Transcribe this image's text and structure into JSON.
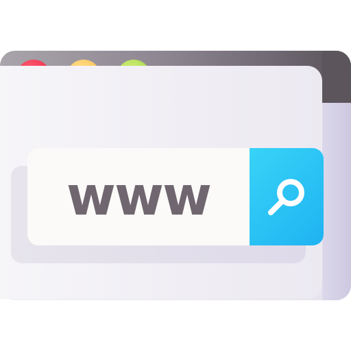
{
  "window": {
    "controls": [
      {
        "name": "close",
        "color": "#f02e4f"
      },
      {
        "name": "minimize",
        "color": "#fbc35a"
      },
      {
        "name": "maximize",
        "color": "#a9da4d"
      }
    ]
  },
  "address_bar": {
    "text": "www",
    "search_button_icon": "magnifier-icon",
    "accent_color": "#1fb3f2"
  }
}
